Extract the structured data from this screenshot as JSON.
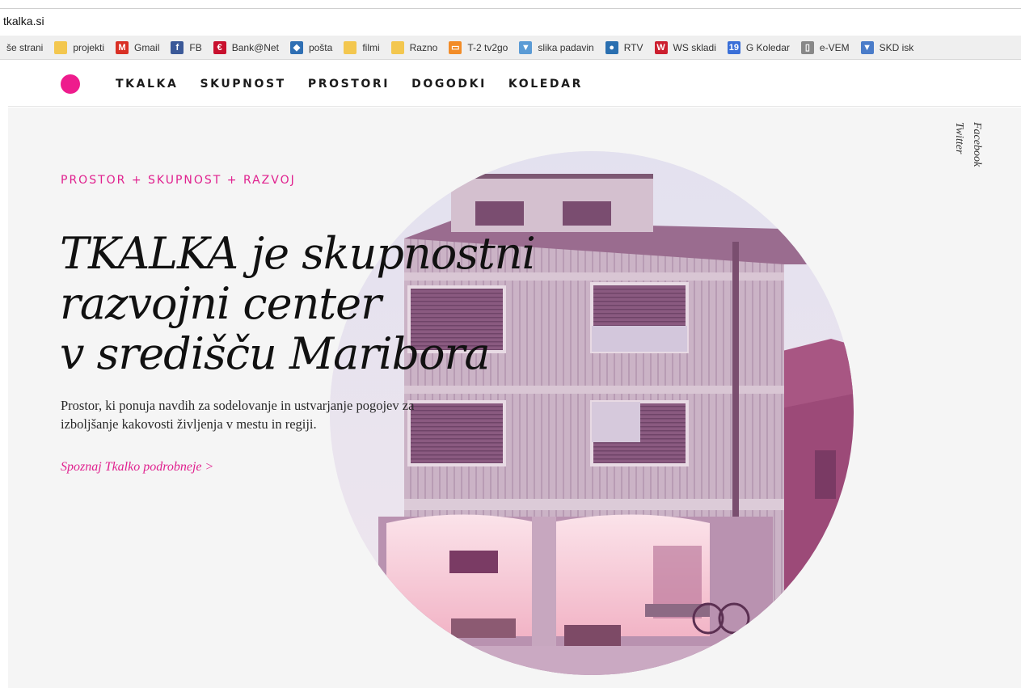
{
  "browser": {
    "url": "tkalka.si",
    "bookmarks": [
      {
        "label": "še strani",
        "icon": "folder-icon",
        "color": "#f3c74f"
      },
      {
        "label": "projekti",
        "icon": "folder-icon",
        "color": "#f3c74f"
      },
      {
        "label": "Gmail",
        "icon": "gmail-icon",
        "color": "#d93025"
      },
      {
        "label": "FB",
        "icon": "facebook-icon",
        "color": "#3b5998"
      },
      {
        "label": "Bank@Net",
        "icon": "bank-icon",
        "color": "#c8102e"
      },
      {
        "label": "pošta",
        "icon": "mail-icon",
        "color": "#2f6fb3"
      },
      {
        "label": "filmi",
        "icon": "folder-icon",
        "color": "#f3c74f"
      },
      {
        "label": "Razno",
        "icon": "folder-icon",
        "color": "#f3c74f"
      },
      {
        "label": "T-2 tv2go",
        "icon": "tv-icon",
        "color": "#f28c28"
      },
      {
        "label": "slika padavin",
        "icon": "weather-icon",
        "color": "#5b9bd5"
      },
      {
        "label": "RTV",
        "icon": "rtv-icon",
        "color": "#2a6fb0"
      },
      {
        "label": "WS skladi",
        "icon": "ws-icon",
        "color": "#cc1f2f"
      },
      {
        "label": "G Koledar",
        "icon": "calendar-icon",
        "color": "#3a6fd8"
      },
      {
        "label": "e-VEM",
        "icon": "page-icon",
        "color": "#888888"
      },
      {
        "label": "SKD isk",
        "icon": "skd-icon",
        "color": "#4a7cc9"
      }
    ]
  },
  "site": {
    "brand_color": "#ee1c8d",
    "nav": [
      "TKALKA",
      "SKUPNOST",
      "PROSTORI",
      "DOGODKI",
      "KOLEDAR"
    ],
    "hero": {
      "tagline": "PROSTOR + SKUPNOST + RAZVOJ",
      "headline_lines": [
        "TKALKA je skupnostni",
        "razvojni center",
        "v središču Maribora"
      ],
      "description": "Prostor, ki ponuja navdih za sodelovanje in ustvarjanje pogojev za izboljšanje kakovosti življenja v mestu in regiji.",
      "more_link": "Spoznaj Tkalko podrobneje >"
    },
    "social": {
      "facebook": "Facebook",
      "twitter": "Twitter"
    }
  }
}
